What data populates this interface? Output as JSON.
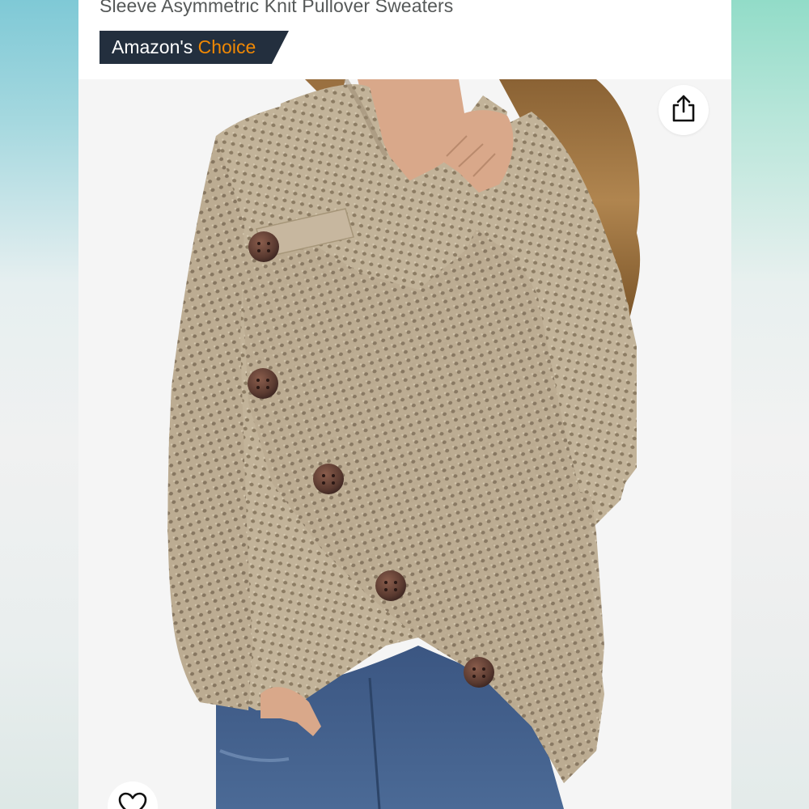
{
  "product": {
    "title": "Sleeve Asymmetric Knit Pullover Sweaters"
  },
  "badge": {
    "prefix": "Amazon's",
    "highlight": "Choice"
  },
  "colors": {
    "badge_bg": "#232f3e",
    "badge_highlight": "#f08804",
    "title_text": "#565959",
    "sweater": "#bfb096",
    "buttons": "#5a3a30",
    "jeans": "#3f5f8c"
  },
  "icons": {
    "share": "share-icon",
    "wishlist": "heart-icon"
  }
}
